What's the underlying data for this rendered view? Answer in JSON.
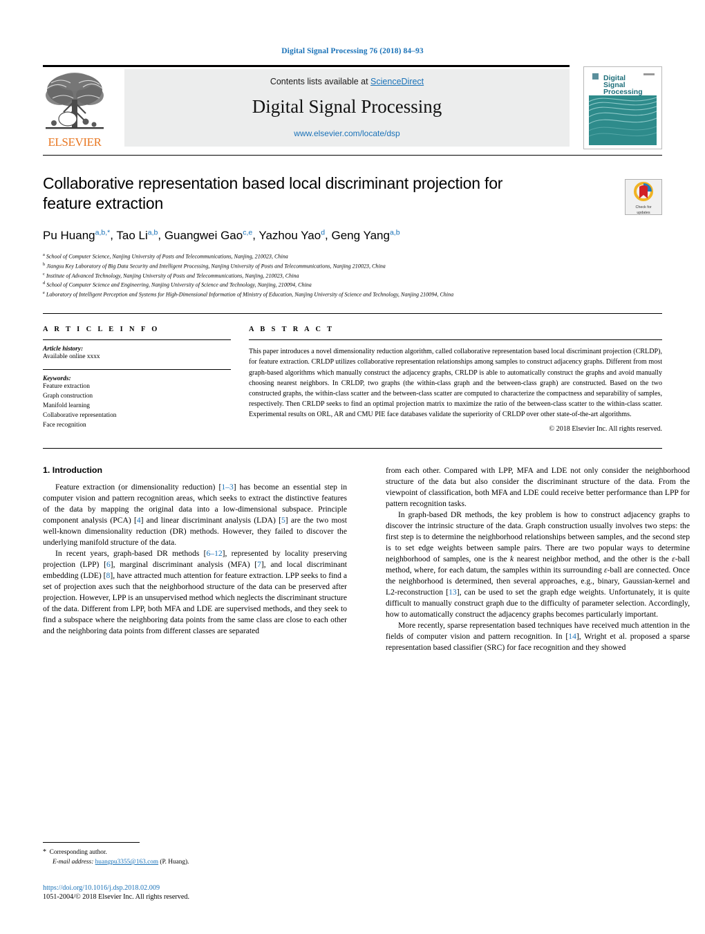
{
  "running_head": "Digital Signal Processing 76 (2018) 84–93",
  "masthead": {
    "publisher_name": "ELSEVIER",
    "contents_prefix": "Contents lists available at ",
    "sciencedirect": "ScienceDirect",
    "journal_name": "Digital Signal Processing",
    "journal_url": "www.elsevier.com/locate/dsp",
    "cover_title_lines": [
      "Digital",
      "Signal",
      "Processing"
    ]
  },
  "article": {
    "title": "Collaborative representation based local discriminant projection for feature extraction",
    "crossmark_line1": "Check for",
    "crossmark_line2": "updates",
    "authors": [
      {
        "name": "Pu Huang",
        "sup": "a,b,*"
      },
      {
        "name": "Tao Li",
        "sup": "a,b"
      },
      {
        "name": "Guangwei Gao",
        "sup": "c,e"
      },
      {
        "name": "Yazhou Yao",
        "sup": "d"
      },
      {
        "name": "Geng Yang",
        "sup": "a,b"
      }
    ],
    "affiliations": [
      {
        "mark": "a",
        "text": "School of Computer Science, Nanjing University of Posts and Telecommunications, Nanjing, 210023, China"
      },
      {
        "mark": "b",
        "text": "Jiangsu Key Laboratory of Big Data Security and Intelligent Processing, Nanjing University of Posts and Telecommunications, Nanjing 210023, China"
      },
      {
        "mark": "c",
        "text": "Institute of Advanced Technology, Nanjing University of Posts and Telecommunications, Nanjing, 210023, China"
      },
      {
        "mark": "d",
        "text": "School of Computer Science and Engineering, Nanjing University of Science and Technology, Nanjing, 210094, China"
      },
      {
        "mark": "e",
        "text": "Laboratory of Intelligent Perception and Systems for High-Dimensional Information of Ministry of Education, Nanjing University of Science and Technology, Nanjing 210094, China"
      }
    ]
  },
  "info": {
    "heading": "A R T I C L E   I N F O",
    "history_label": "Article history:",
    "history_value": "Available online xxxx",
    "keywords_label": "Keywords:",
    "keywords": [
      "Feature extraction",
      "Graph construction",
      "Manifold learning",
      "Collaborative representation",
      "Face recognition"
    ]
  },
  "abstract": {
    "heading": "A B S T R A C T",
    "text": "This paper introduces a novel dimensionality reduction algorithm, called collaborative representation based local discriminant projection (CRLDP), for feature extraction. CRLDP utilizes collaborative representation relationships among samples to construct adjacency graphs. Different from most graph-based algorithms which manually construct the adjacency graphs, CRLDP is able to automatically construct the graphs and avoid manually choosing nearest neighbors. In CRLDP, two graphs (the within-class graph and the between-class graph) are constructed. Based on the two constructed graphs, the within-class scatter and the between-class scatter are computed to characterize the compactness and separability of samples, respectively. Then CRLDP seeks to find an optimal projection matrix to maximize the ratio of the between-class scatter to the within-class scatter. Experimental results on ORL, AR and CMU PIE face databases validate the superiority of CRLDP over other state-of-the-art algorithms.",
    "copyright": "© 2018 Elsevier Inc. All rights reserved."
  },
  "body": {
    "section_title": "1. Introduction",
    "left_paragraphs": [
      "Feature extraction (or dimensionality reduction) [1–3] has become an essential step in computer vision and pattern recognition areas, which seeks to extract the distinctive features of the data by mapping the original data into a low-dimensional subspace. Principle component analysis (PCA) [4] and linear discriminant analysis (LDA) [5] are the two most well-known dimensionality reduction (DR) methods. However, they failed to discover the underlying manifold structure of the data.",
      "In recent years, graph-based DR methods [6–12], represented by locality preserving projection (LPP) [6], marginal discriminant analysis (MFA) [7], and local discriminant embedding (LDE) [8], have attracted much attention for feature extraction. LPP seeks to find a set of projection axes such that the neighborhood structure of the data can be preserved after projection. However, LPP is an unsupervised method which neglects the discriminant structure of the data. Different from LPP, both MFA and LDE are supervised methods, and they seek to find a subspace where the neighboring data points from the same class are close to each other and the neighboring data points from different classes are separated"
    ],
    "right_paragraphs": [
      "from each other. Compared with LPP, MFA and LDE not only consider the neighborhood structure of the data but also consider the discriminant structure of the data. From the viewpoint of classification, both MFA and LDE could receive better performance than LPP for pattern recognition tasks.",
      "In graph-based DR methods, the key problem is how to construct adjacency graphs to discover the intrinsic structure of the data. Graph construction usually involves two steps: the first step is to determine the neighborhood relationships between samples, and the second step is to set edge weights between sample pairs. There are two popular ways to determine neighborhood of samples, one is the k nearest neighbor method, and the other is the ε-ball method, where, for each datum, the samples within its surrounding ε-ball are connected. Once the neighborhood is determined, then several approaches, e.g., binary, Gaussian-kernel and L2-reconstruction [13], can be used to set the graph edge weights. Unfortunately, it is quite difficult to manually construct graph due to the difficulty of parameter selection. Accordingly, how to automatically construct the adjacency graphs becomes particularly important.",
      "More recently, sparse representation based techniques have received much attention in the fields of computer vision and pattern recognition. In [14], Wright et al. proposed a sparse representation based classifier (SRC) for face recognition and they showed"
    ]
  },
  "footer": {
    "corresponding_star": "*",
    "corresponding_label": "Corresponding author.",
    "email_label": "E-mail address:",
    "email": "huangpu3355@163.com",
    "email_owner": "(P. Huang).",
    "doi": "https://doi.org/10.1016/j.dsp.2018.02.009",
    "issn_line": "1051-2004/© 2018 Elsevier Inc. All rights reserved."
  },
  "colors": {
    "link_blue": "#1a72b8",
    "elsevier_orange": "#e87722",
    "cover_teal": "#2e8b8b",
    "masthead_gray": "#eceded"
  }
}
